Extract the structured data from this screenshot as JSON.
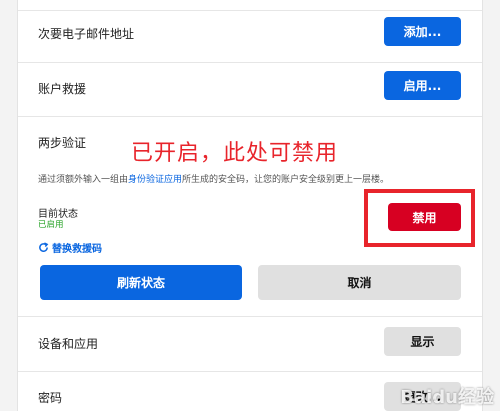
{
  "secondary_email": {
    "label": "次要电子邮件地址",
    "button": "添加..."
  },
  "account_recovery": {
    "label": "账户救援",
    "button": "启用..."
  },
  "two_step": {
    "label": "两步验证",
    "annotation": "已开启，此处可禁用",
    "description_pre": "通过须额外输入一组由",
    "description_link": "身份验证应用",
    "description_post": "所生成的安全码，让您的账户安全级别更上一层楼。",
    "status_label": "目前状态",
    "status_value": "已启用",
    "disable_button": "禁用",
    "change_codes": "替换救援码",
    "refresh_button": "刷新状态",
    "cancel_button": "取消"
  },
  "devices": {
    "label": "设备和应用",
    "button": "显示"
  },
  "password": {
    "label": "密码",
    "button": "更改..."
  },
  "watermark": "Baidu经验",
  "colors": {
    "accent": "#0a66e0",
    "danger": "#d70022",
    "annotation": "#e8242b",
    "success": "#29a329"
  }
}
